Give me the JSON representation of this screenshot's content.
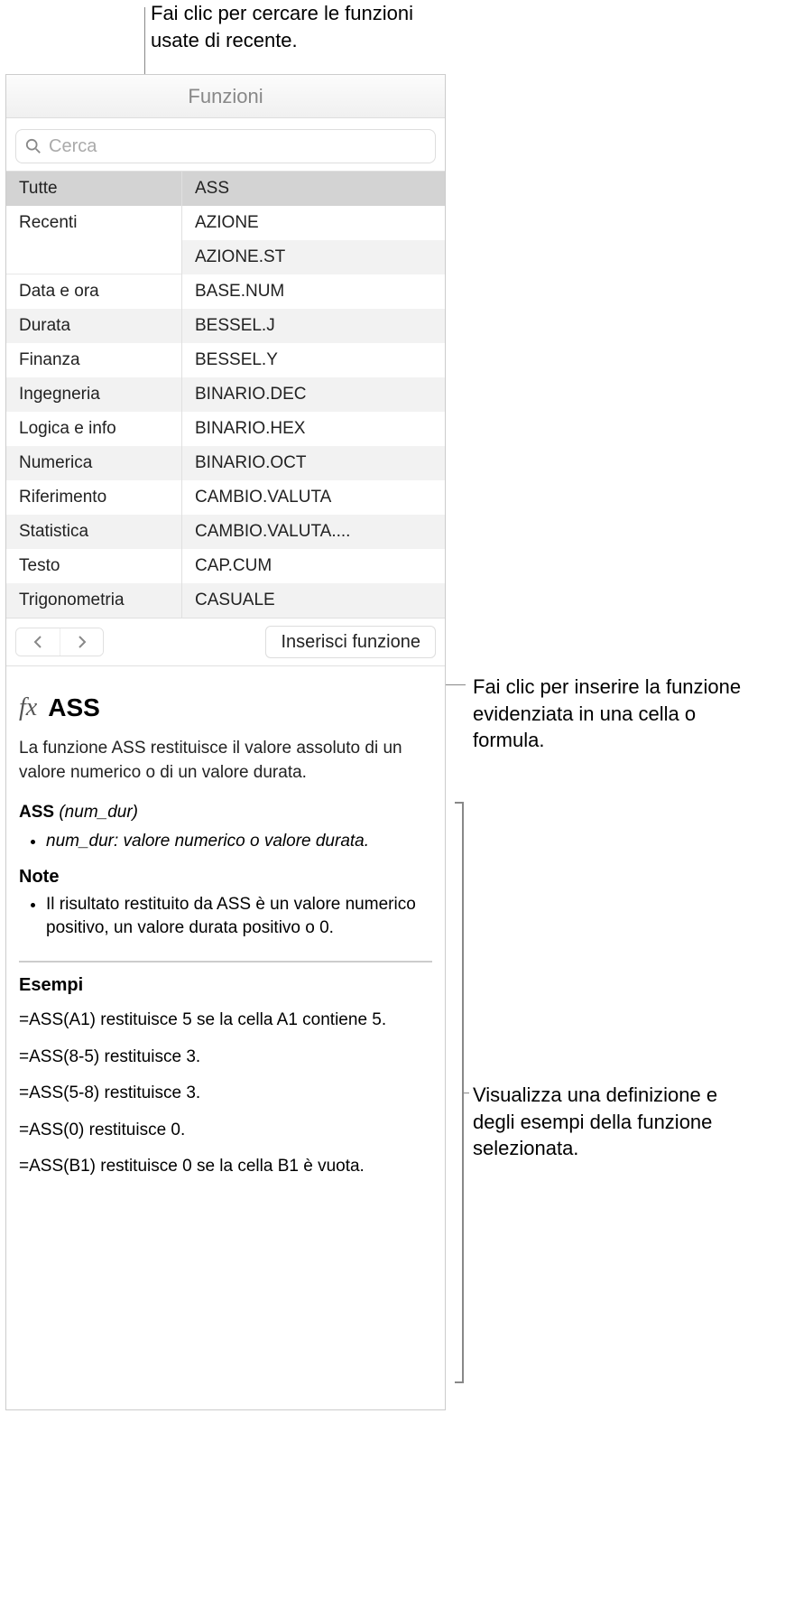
{
  "callouts": {
    "top": "Fai clic per cercare le funzioni usate di recente.",
    "insert": "Fai clic per inserire la funzione evidenziata in una cella o formula.",
    "detail": "Visualizza una definizione e degli esempi della funzione selezionata."
  },
  "header": {
    "title": "Funzioni"
  },
  "search": {
    "placeholder": "Cerca"
  },
  "categories": [
    "Tutte",
    "Recenti",
    "",
    "Data e ora",
    "Durata",
    "Finanza",
    "Ingegneria",
    "Logica e info",
    "Numerica",
    "Riferimento",
    "Statistica",
    "Testo",
    "Trigonometria"
  ],
  "functions": [
    "ASS",
    "AZIONE",
    "AZIONE.ST",
    "BASE.NUM",
    "BESSEL.J",
    "BESSEL.Y",
    "BINARIO.DEC",
    "BINARIO.HEX",
    "BINARIO.OCT",
    "CAMBIO.VALUTA",
    "CAMBIO.VALUTA....",
    "CAP.CUM",
    "CASUALE"
  ],
  "selected_category_index": 0,
  "selected_function_index": 0,
  "insert_button": "Inserisci funzione",
  "fx_symbol": "fx",
  "detail": {
    "name": "ASS",
    "description": "La funzione ASS restituisce il valore assoluto di un valore numerico o di un valore durata.",
    "syntax_name": "ASS",
    "syntax_args": "(num_dur)",
    "param_desc": "num_dur: valore numerico o valore durata.",
    "notes_heading": "Note",
    "notes": [
      "Il risultato restituito da ASS è un valore numerico positivo, un valore durata positivo o 0."
    ],
    "examples_heading": "Esempi",
    "examples": [
      "=ASS(A1) restituisce 5 se la cella A1 contiene 5.",
      "=ASS(8-5) restituisce 3.",
      "=ASS(5-8) restituisce 3.",
      "=ASS(0) restituisce 0.",
      "=ASS(B1) restituisce 0 se la cella B1 è vuota."
    ]
  }
}
